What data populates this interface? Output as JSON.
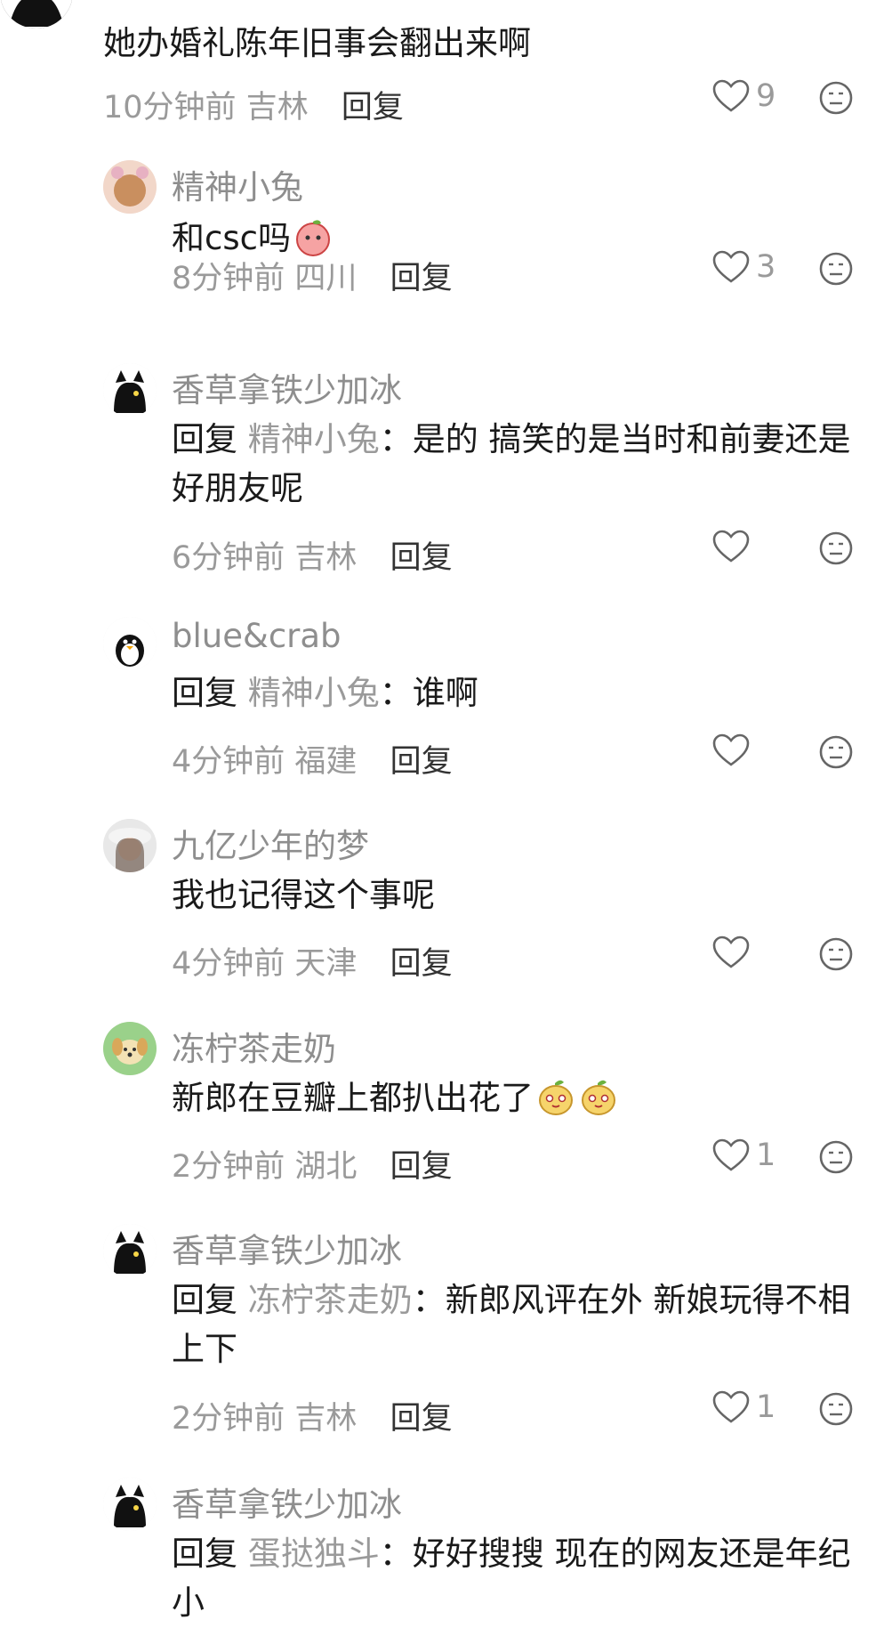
{
  "root": {
    "text": "她办婚礼陈年旧事会翻出来啊",
    "time": "10分钟前",
    "location": "吉林",
    "reply_label": "回复",
    "likes": "9"
  },
  "replies": [
    {
      "username": "精神小兔",
      "prefix": "",
      "mention": "",
      "text": "和csc吗",
      "time": "8分钟前",
      "location": "四川",
      "reply_label": "回复",
      "likes": "3"
    },
    {
      "username": "香草拿铁少加冰",
      "prefix": "回复",
      "mention": "精神小兔",
      "text": "：是的 搞笑的是当时和前妻还是好朋友呢",
      "time": "6分钟前",
      "location": "吉林",
      "reply_label": "回复",
      "likes": ""
    },
    {
      "username": "blue&crab",
      "prefix": "回复",
      "mention": "精神小兔",
      "text": "：谁啊",
      "time": "4分钟前",
      "location": "福建",
      "reply_label": "回复",
      "likes": ""
    },
    {
      "username": "九亿少年的梦",
      "prefix": "",
      "mention": "",
      "text": "我也记得这个事呢",
      "time": "4分钟前",
      "location": "天津",
      "reply_label": "回复",
      "likes": ""
    },
    {
      "username": "冻柠茶走奶",
      "prefix": "",
      "mention": "",
      "text": "新郎在豆瓣上都扒出花了",
      "time": "2分钟前",
      "location": "湖北",
      "reply_label": "回复",
      "likes": "1"
    },
    {
      "username": "香草拿铁少加冰",
      "prefix": "回复",
      "mention": "冻柠茶走奶",
      "text": "：新郎风评在外 新娘玩得不相上下",
      "time": "2分钟前",
      "location": "吉林",
      "reply_label": "回复",
      "likes": "1"
    },
    {
      "username": "香草拿铁少加冰",
      "prefix": "回复",
      "mention": "蛋挞独斗",
      "text": "：好好搜搜 现在的网友还是年纪小",
      "time": "",
      "location": "",
      "reply_label": "",
      "likes": ""
    }
  ],
  "colors": {
    "meta": "#9a9a9a",
    "text": "#1a1a1a",
    "username": "#8e8e8e"
  }
}
